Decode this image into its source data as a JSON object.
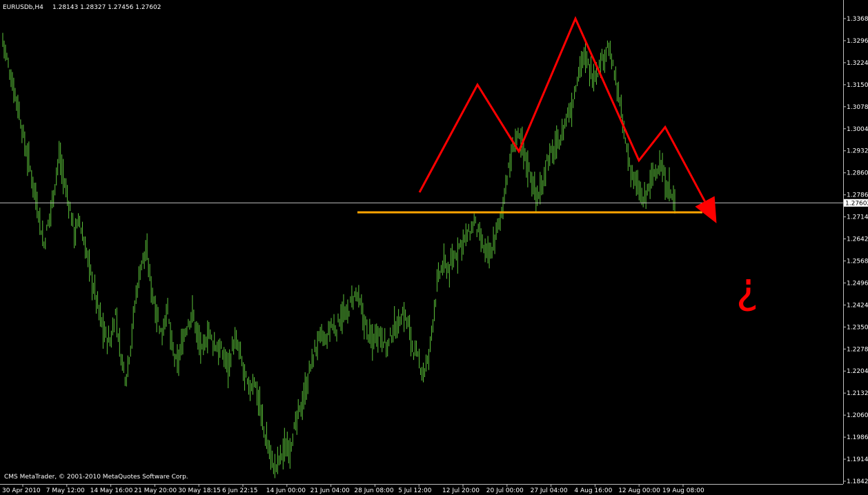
{
  "window": {
    "symbol_timeframe": "EURUSDb,H4",
    "ohlc": "1.28143 1.28327 1.27456 1.27602",
    "copyright": "CMS MetaTrader, © 2001-2010 MetaQuotes Software Corp."
  },
  "colors": {
    "background": "#000000",
    "bars": "#5cc43a",
    "axis": "#c0c0c0",
    "price_line": "#c0c0c0",
    "pattern": "#ff0000",
    "neckline": "#ffa500",
    "price_tag_bg": "#ffffff",
    "price_tag_text": "#000000"
  },
  "annotation": {
    "question_mark": "?"
  },
  "chart_data": {
    "type": "bar",
    "title": "EURUSDb,H4",
    "ylim": [
      1.1842,
      1.3368
    ],
    "y_ticks": [
      "1.33680",
      "1.32960",
      "1.32240",
      "1.31500",
      "1.30780",
      "1.30040",
      "1.29320",
      "1.28600",
      "1.27860",
      "1.27140",
      "1.26420",
      "1.25680",
      "1.24960",
      "1.24240",
      "1.23500",
      "1.22780",
      "1.22040",
      "1.21320",
      "1.20600",
      "1.19860",
      "1.19140",
      "1.18420"
    ],
    "x_ticks": [
      "30 Apr 2010",
      "7 May 12:00",
      "14 May 16:00",
      "21 May 20:00",
      "30 May 18:15",
      "6 Jun 22:15",
      "14 Jun 00:00",
      "21 Jun 04:00",
      "28 Jun 08:00",
      "5 Jul 12:00",
      "12 Jul 20:00",
      "20 Jul 00:00",
      "27 Jul 04:00",
      "4 Aug 16:00",
      "12 Aug 00:00",
      "19 Aug 08:00"
    ],
    "current_price": 1.27602,
    "current_price_label": "1.27602",
    "neckline_price": 1.2729,
    "price_path": [
      1.33,
      1.322,
      1.315,
      1.308,
      1.298,
      1.29,
      1.282,
      1.273,
      1.262,
      1.27,
      1.28,
      1.292,
      1.283,
      1.275,
      1.266,
      1.27,
      1.262,
      1.254,
      1.246,
      1.238,
      1.232,
      1.23,
      1.24,
      1.226,
      1.218,
      1.23,
      1.246,
      1.256,
      1.26,
      1.248,
      1.24,
      1.232,
      1.242,
      1.228,
      1.222,
      1.23,
      1.236,
      1.24,
      1.232,
      1.226,
      1.234,
      1.23,
      1.228,
      1.226,
      1.222,
      1.23,
      1.228,
      1.22,
      1.214,
      1.218,
      1.21,
      1.2,
      1.194,
      1.188,
      1.192,
      1.195,
      1.196,
      1.202,
      1.208,
      1.214,
      1.222,
      1.228,
      1.232,
      1.23,
      1.236,
      1.234,
      1.24,
      1.238,
      1.244,
      1.246,
      1.24,
      1.234,
      1.23,
      1.234,
      1.232,
      1.228,
      1.234,
      1.236,
      1.24,
      1.236,
      1.228,
      1.224,
      1.22,
      1.224,
      1.24,
      1.252,
      1.256,
      1.254,
      1.258,
      1.262,
      1.264,
      1.266,
      1.27,
      1.264,
      1.26,
      1.258,
      1.265,
      1.27,
      1.282,
      1.29,
      1.298,
      1.296,
      1.29,
      1.285,
      1.278,
      1.28,
      1.29,
      1.292,
      1.295,
      1.298,
      1.305,
      1.308,
      1.318,
      1.324,
      1.322,
      1.318,
      1.32,
      1.324,
      1.328,
      1.32,
      1.312,
      1.3,
      1.29,
      1.284,
      1.28,
      1.276,
      1.282,
      1.286,
      1.289,
      1.284,
      1.28,
      1.276
    ],
    "pattern_line": [
      [
        1.2795,
        "8 Jul"
      ],
      [
        1.315,
        "14 Jul"
      ],
      [
        1.293,
        "25 Jul"
      ],
      [
        1.3368,
        "4 Aug"
      ],
      [
        1.29,
        "13 Aug"
      ],
      [
        1.301,
        "17 Aug"
      ],
      [
        1.2729,
        "22 Aug"
      ]
    ]
  }
}
